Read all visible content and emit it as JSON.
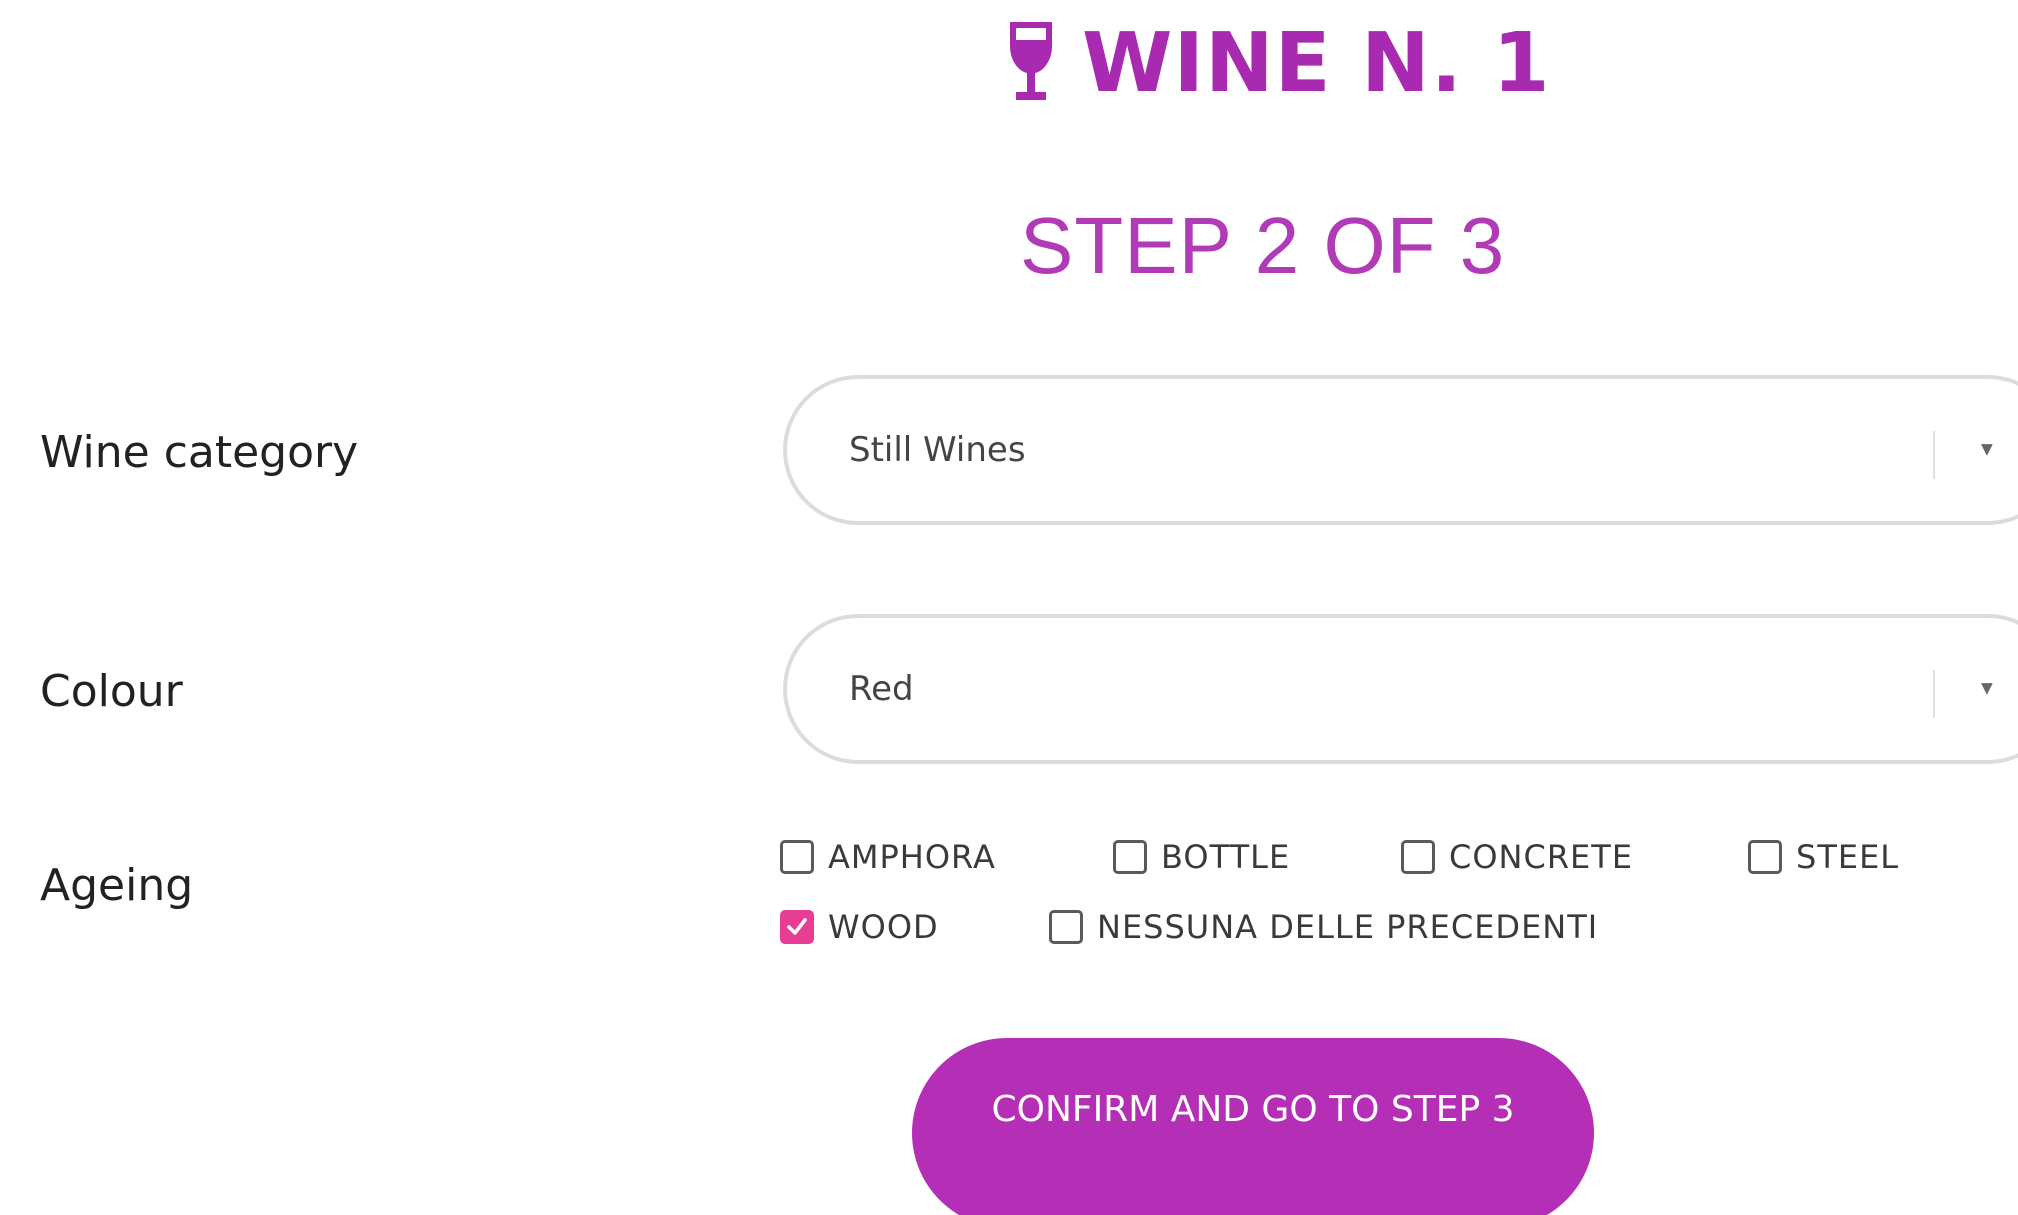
{
  "header": {
    "title": "WINE N. 1",
    "icon": "wine-glass-icon",
    "color": "#a82ab0"
  },
  "step": {
    "label": "STEP 2 OF 3"
  },
  "form": {
    "category": {
      "label": "Wine category",
      "value": "Still Wines"
    },
    "colour": {
      "label": "Colour",
      "value": "Red"
    },
    "ageing": {
      "label": "Ageing",
      "options": [
        {
          "label": "AMPHORA",
          "checked": false
        },
        {
          "label": "BOTTLE",
          "checked": false
        },
        {
          "label": "CONCRETE",
          "checked": false
        },
        {
          "label": "STEEL",
          "checked": false
        },
        {
          "label": "WOOD",
          "checked": true
        },
        {
          "label": "NESSUNA DELLE PRECEDENTI",
          "checked": false
        }
      ]
    }
  },
  "actions": {
    "confirm_label": "CONFIRM AND GO TO STEP 3",
    "button_color": "#b42fb6"
  },
  "colors": {
    "checkbox_checked": "#e83d94",
    "input_border": "#dcdcdc"
  }
}
